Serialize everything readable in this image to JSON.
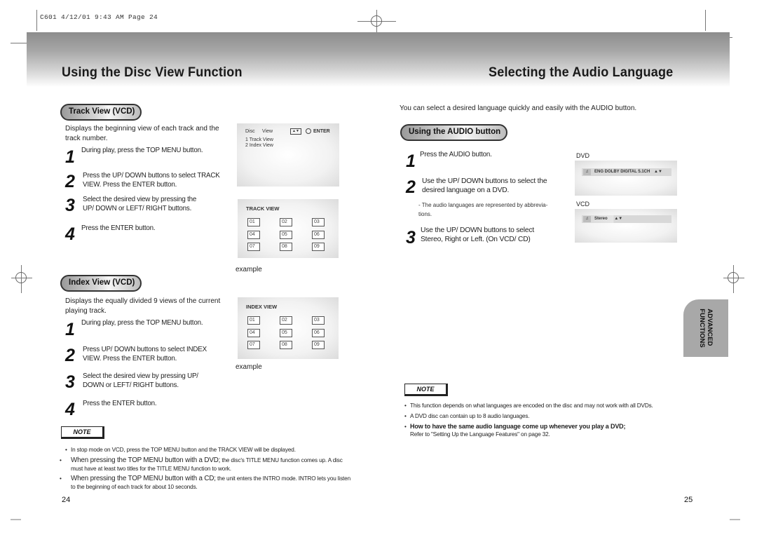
{
  "print_slug": "C601   4/12/01  9:43 AM   Page 24",
  "left_page": {
    "title": "Using the Disc View Function",
    "track_view": {
      "label": "Track View (VCD)",
      "intro": "Displays the beginning view of each track and the track number.",
      "steps": [
        {
          "num": "1",
          "text": "During play, press the TOP MENU button."
        },
        {
          "num": "2",
          "text": "Press the UP/ DOWN buttons to select TRACK VIEW. Press the ENTER button."
        },
        {
          "num": "3",
          "text": "Select the desired view by pressing the UP/ DOWN or LEFT/ RIGHT buttons."
        },
        {
          "num": "4",
          "text": "Press the ENTER button."
        }
      ],
      "menu_screen": {
        "header_left": "Disc",
        "header_mid": "View",
        "nav_glyph": "▲▼",
        "enter_icon": "enter-icon",
        "enter_label": "ENTER",
        "items": [
          "1 Track   View",
          "2 Index   View"
        ]
      },
      "grid_screen": {
        "title": "TRACK VIEW",
        "cells": [
          "01",
          "02",
          "03",
          "04",
          "05",
          "06",
          "07",
          "08",
          "09"
        ]
      },
      "example_label": "example"
    },
    "index_view": {
      "label": "Index View (VCD)",
      "intro": "Displays the equally divided 9 views of the current playing track.",
      "steps": [
        {
          "num": "1",
          "text": "During play, press the TOP MENU button."
        },
        {
          "num": "2",
          "text": "Press UP/ DOWN buttons to select INDEX VIEW. Press the ENTER button."
        },
        {
          "num": "3",
          "text": "Select the desired view by pressing UP/ DOWN or LEFT/ RIGHT buttons."
        },
        {
          "num": "4",
          "text": "Press the ENTER button."
        }
      ],
      "grid_screen": {
        "title": "INDEX VIEW",
        "cells": [
          "01",
          "02",
          "03",
          "04",
          "05",
          "06",
          "07",
          "08",
          "09"
        ]
      },
      "example_label": "example"
    },
    "note": {
      "label": "NOTE",
      "bullets": [
        {
          "lead": "",
          "text": "In stop mode on VCD, press the TOP MENU button and the TRACK VIEW will be displayed."
        },
        {
          "lead": "When pressing the TOP MENU button with a DVD;",
          "text": " the disc's TITLE MENU function comes up. A disc must have at least two titles for the TITLE MENU function to work."
        },
        {
          "lead": "When pressing the TOP MENU button with a CD;",
          "text": " the unit enters the INTRO mode. INTRO lets you listen to the beginning of each track for about 10 seconds."
        }
      ]
    },
    "page_number": "24"
  },
  "right_page": {
    "title": "Selecting the Audio Language",
    "intro": "You can select a desired language quickly and easily with the AUDIO button.",
    "audio_button": {
      "label": "Using the AUDIO button",
      "steps": [
        {
          "num": "1",
          "text": "Press the AUDIO button."
        },
        {
          "num": "2",
          "text": "Use the UP/ DOWN buttons to select the desired language on a DVD."
        },
        {
          "num": "3",
          "text": "Use the UP/ DOWN buttons to select Stereo, Right or Left. (On VCD/ CD)"
        }
      ],
      "sub_note": "- The audio languages are represented by abbrevia-tions."
    },
    "osd": {
      "dvd_label": "DVD",
      "dvd_text": "ENG  DOLBY  DIGITAL  5.1CH",
      "vcd_label": "VCD",
      "vcd_text": "Stereo",
      "nav_glyph": "▲▼",
      "audio_icon": "audio-icon"
    },
    "note": {
      "label": "NOTE",
      "bullets": [
        "This function depends on what languages are encoded on the disc and may not work with all DVDs.",
        "A DVD disc can contain up to 8 audio languages."
      ],
      "bold_bullet": "How to have the same audio language come up whenever you play a DVD;",
      "bold_bullet_sub": "Refer to \"Setting Up the Language Features\" on page 32."
    },
    "side_tab": {
      "line1": "ADVANCED",
      "line2": "FUNCTIONS"
    },
    "page_number": "25"
  }
}
